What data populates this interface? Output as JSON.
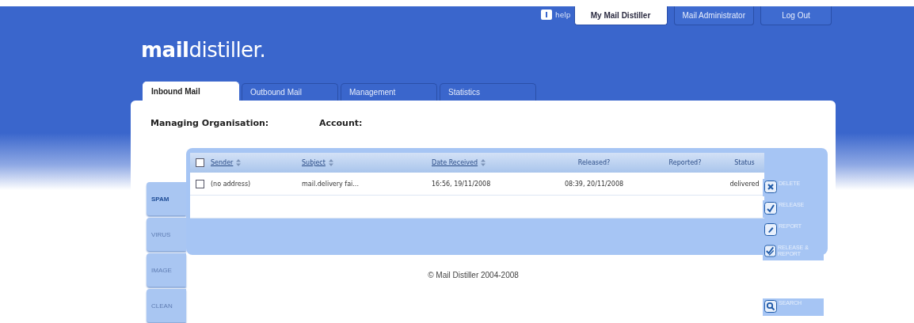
{
  "top_nav": {
    "help": "help",
    "buttons": [
      {
        "label": "My Mail Distiller",
        "selected": true
      },
      {
        "label": "Mail Administrator",
        "selected": false
      },
      {
        "label": "Log Out",
        "selected": false
      }
    ]
  },
  "logo": "**mail**distiller.",
  "tabs": [
    {
      "label": "Inbound Mail",
      "selected": true
    },
    {
      "label": "Outbound Mail",
      "selected": false
    },
    {
      "label": "Management",
      "selected": false
    },
    {
      "label": "Statistics",
      "selected": false
    }
  ],
  "info": [
    {
      "label": "Managing Organisation:"
    },
    {
      "label": "Account:"
    }
  ],
  "side_tabs": [
    {
      "label": "SPAM",
      "selected": true
    },
    {
      "label": "VIRUS",
      "selected": false
    },
    {
      "label": "IMAGE",
      "selected": false
    },
    {
      "label": "CLEAN",
      "selected": false
    }
  ],
  "table": {
    "select_all_checked": false,
    "columns": [
      {
        "label": "Sender",
        "sortable": true
      },
      {
        "label": "Subject",
        "sortable": true
      },
      {
        "label": "Date Received",
        "sortable": true
      },
      {
        "label": "Released?",
        "sortable": false
      },
      {
        "label": "Reported?",
        "sortable": false
      },
      {
        "label": "Status",
        "sortable": false
      }
    ],
    "rows": [
      {
        "checked": false,
        "cells": [
          "(no address)",
          "mail.delivery fai...",
          "16:56, 19/11/2008",
          "08:39, 20/11/2008",
          "",
          "delivered"
        ]
      }
    ]
  },
  "actions": [
    {
      "kind": "delete",
      "label": "DELETE"
    },
    {
      "kind": "release",
      "label": "RELEASE"
    },
    {
      "kind": "report",
      "label": "REPORT"
    },
    {
      "kind": "release_report",
      "label": "RELEASE & REPORT"
    },
    {
      "kind": "search",
      "label": "SEARCH"
    }
  ],
  "footer": "© Mail Distiller 2004-2008"
}
